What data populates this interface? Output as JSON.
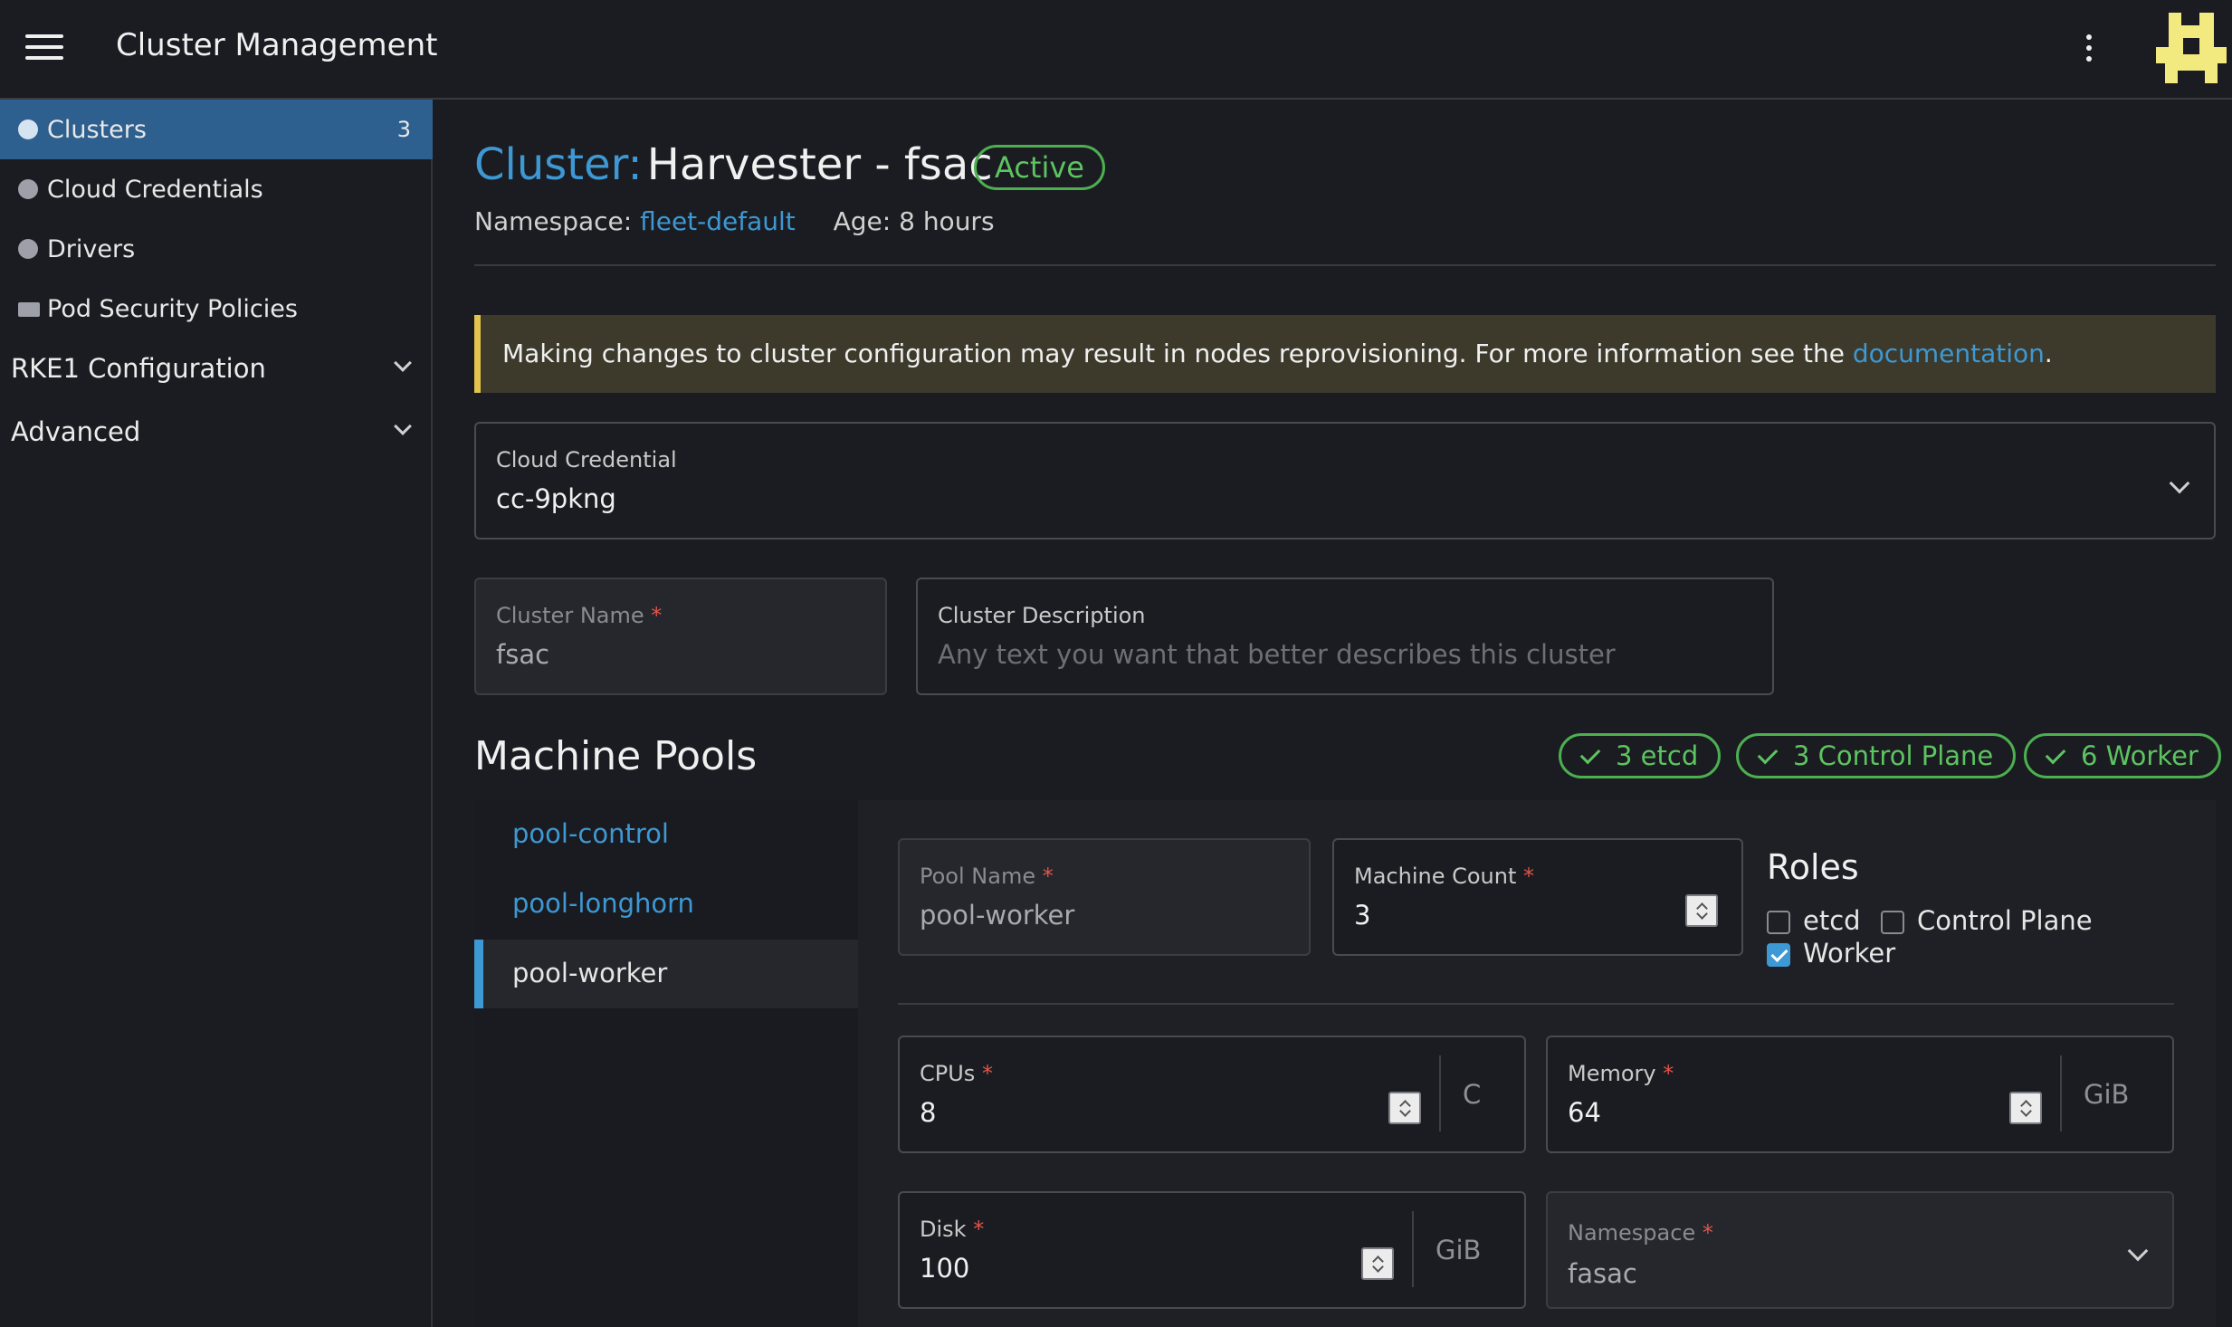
{
  "header": {
    "title": "Cluster Management",
    "menu_icon": "hamburger-icon",
    "more_icon": "kebab-icon"
  },
  "sidebar": {
    "items": [
      {
        "label": "Clusters",
        "count": "3",
        "icon": "globe-icon",
        "active": true
      },
      {
        "label": "Cloud Credentials",
        "icon": "globe-icon"
      },
      {
        "label": "Drivers",
        "icon": "globe-icon"
      },
      {
        "label": "Pod Security Policies",
        "icon": "folder-icon"
      }
    ],
    "groups": [
      {
        "label": "RKE1 Configuration"
      },
      {
        "label": "Advanced"
      }
    ]
  },
  "page": {
    "title_prefix": "Cluster:",
    "title_name": "Harvester - fsac",
    "status": "Active",
    "namespace_label": "Namespace:",
    "namespace_value": "fleet-default",
    "age_label": "Age: 8 hours"
  },
  "banner": {
    "text": "Making changes to cluster configuration may result in nodes reprovisioning. For more information see the ",
    "link": "documentation",
    "suffix": "."
  },
  "form": {
    "cloud_credential": {
      "label": "Cloud Credential",
      "value": "cc-9pkng"
    },
    "cluster_name": {
      "label": "Cluster Name",
      "required": "*",
      "value": "fsac"
    },
    "cluster_description": {
      "label": "Cluster Description",
      "placeholder": "Any text you want that better describes this cluster"
    }
  },
  "machine_pools": {
    "title": "Machine Pools",
    "summary": [
      "3 etcd",
      "3 Control Plane",
      "6 Worker"
    ],
    "pools": [
      "pool-control",
      "pool-longhorn",
      "pool-worker"
    ],
    "selected": {
      "pool_name": {
        "label": "Pool Name",
        "required": "*",
        "value": "pool-worker"
      },
      "machine_count": {
        "label": "Machine Count",
        "required": "*",
        "value": "3"
      },
      "roles": {
        "title": "Roles",
        "etcd": {
          "label": "etcd",
          "checked": false
        },
        "control_plane": {
          "label": "Control Plane",
          "checked": false
        },
        "worker": {
          "label": "Worker",
          "checked": true
        }
      },
      "cpus": {
        "label": "CPUs",
        "required": "*",
        "value": "8",
        "unit": "C"
      },
      "memory": {
        "label": "Memory",
        "required": "*",
        "value": "64",
        "unit": "GiB"
      },
      "disk": {
        "label": "Disk",
        "required": "*",
        "value": "100",
        "unit": "GiB"
      },
      "namespace": {
        "label": "Namespace",
        "required": "*",
        "value": "fasac"
      }
    }
  },
  "colors": {
    "accent": "#3d98d3",
    "active_nav": "#2d5f8f",
    "success": "#5cc460",
    "warning": "#e2c34d"
  }
}
